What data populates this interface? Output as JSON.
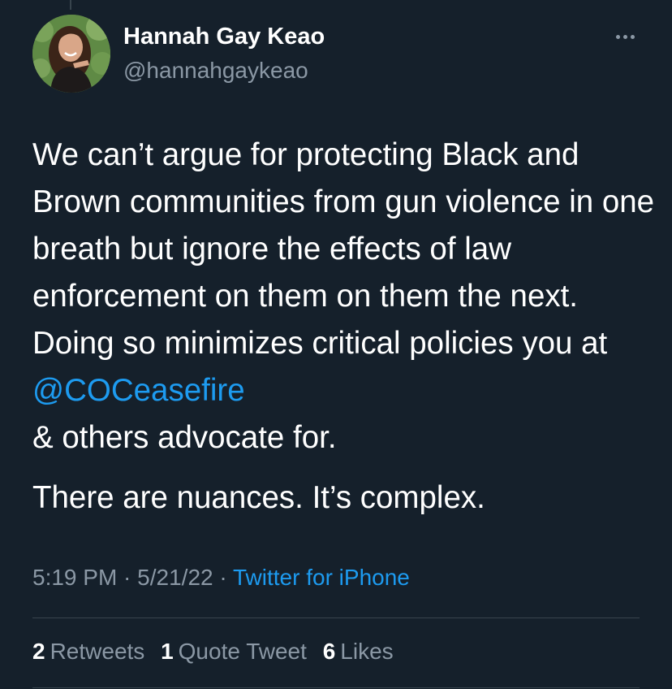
{
  "author": {
    "display_name": "Hannah Gay Keao",
    "handle": "@hannahgaykeao",
    "avatar_icon": "profile-photo"
  },
  "tweet": {
    "paragraph1_before_mention": "We can’t argue for protecting Black and Brown communities from gun violence in one breath but ignore the effects of law enforcement on them on them the next. Doing so minimizes critical policies you at ",
    "mention": "@COCeasefire",
    "paragraph1_after_mention": "\n& others advocate for.",
    "paragraph2": "There are nuances. It’s complex."
  },
  "meta": {
    "time": "5:19 PM",
    "separator": " · ",
    "date": "5/21/22",
    "source": "Twitter for iPhone"
  },
  "stats": {
    "retweets_count": "2",
    "retweets_label": "Retweets",
    "quotes_count": "1",
    "quotes_label": "Quote Tweet",
    "likes_count": "6",
    "likes_label": "Likes"
  },
  "colors": {
    "background": "#15202b",
    "text": "#ffffff",
    "secondary_text": "#8b98a5",
    "link": "#1d9bf0",
    "divider": "#38444d"
  }
}
